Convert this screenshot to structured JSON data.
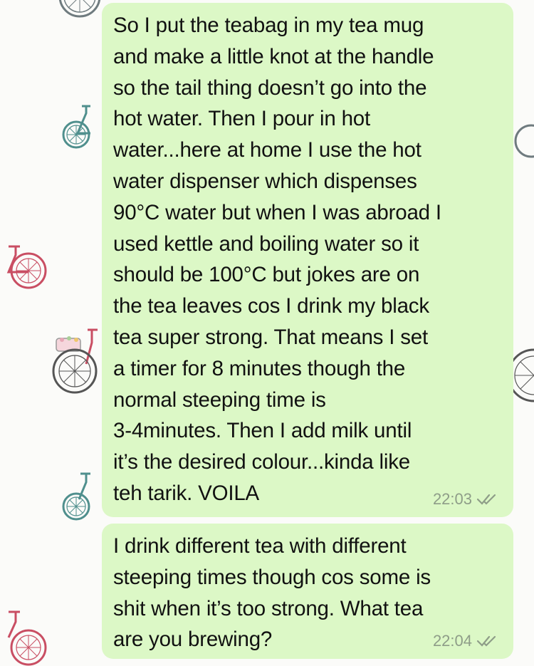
{
  "chat": {
    "messages": [
      {
        "text": "So I put the teabag in my tea mug\nand make a little knot at the handle\nso the tail thing doesn’t go into the\nhot water. Then I pour in hot\nwater...here at home I use the hot\nwater dispenser which dispenses\n90°C water but when I was abroad I\nused kettle and boiling water so it\nshould be 100°C but jokes are on\nthe tea leaves cos I drink my black\ntea super strong. That means I set\na timer for 8 minutes though the\nnormal steeping time is\n3-4minutes. Then I add milk until\nit’s the desired colour...kinda like\nteh tarik. VOILA",
        "time": "22:03",
        "status_icon": "double-check-icon"
      },
      {
        "text": "I drink different tea with different\nsteeping times though cos some is\nshit when it’s too strong. What tea\nare you brewing?",
        "time": "22:04",
        "status_icon": "double-check-icon"
      }
    ]
  },
  "theme": {
    "bubble_color": "#dcf8c6",
    "background_color": "#fbfbf9",
    "red_bike_color": "#c94e63",
    "gray_bike_color": "#6f7b7f",
    "teal_bike_color": "#4f8f8d"
  },
  "wallpaper": {
    "icons": [
      "bicycle-icon",
      "bicycle-icon",
      "bicycle-icon",
      "bicycle-icon",
      "bicycle-icon",
      "bicycle-icon",
      "bicycle-icon",
      "bicycle-icon"
    ]
  }
}
